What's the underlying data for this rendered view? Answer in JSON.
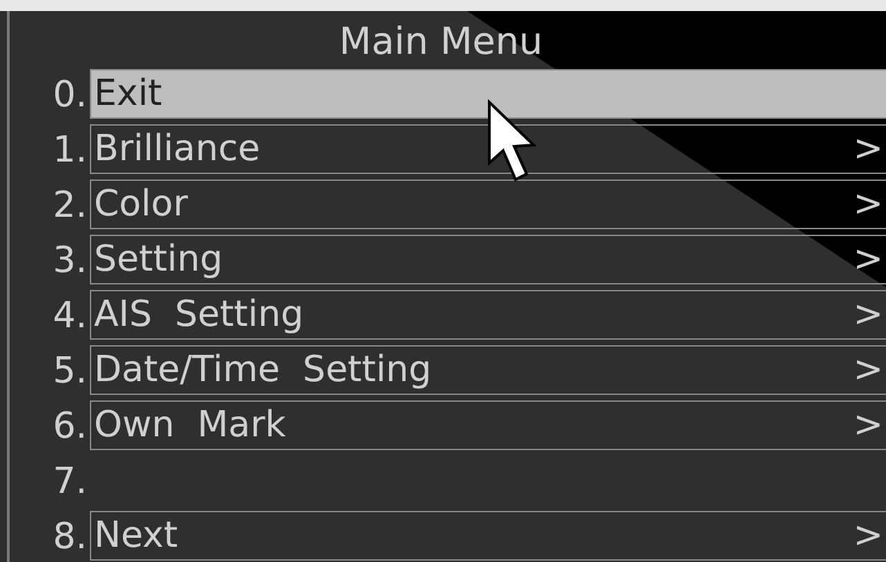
{
  "menu": {
    "title": "Main Menu",
    "items": [
      {
        "kind": "entry",
        "number": "0.",
        "label": "Exit",
        "selected": true
      },
      {
        "kind": "entry",
        "number": "1.",
        "label": "Brilliance",
        "selected": false,
        "arrow": ">"
      },
      {
        "kind": "entry",
        "number": "2.",
        "label": "Color",
        "selected": false,
        "arrow": ">"
      },
      {
        "kind": "entry",
        "number": "3.",
        "label": "Setting",
        "selected": false,
        "arrow": ">"
      },
      {
        "kind": "entry",
        "number": "4.",
        "label": "AIS  Setting",
        "selected": false,
        "arrow": ">"
      },
      {
        "kind": "entry",
        "number": "5.",
        "label": "Date/Time  Setting",
        "selected": false,
        "arrow": ">"
      },
      {
        "kind": "entry",
        "number": "6.",
        "label": "Own  Mark",
        "selected": false,
        "arrow": ">"
      },
      {
        "kind": "blank",
        "number": "7."
      },
      {
        "kind": "entry",
        "number": "8.",
        "label": "Next",
        "selected": false,
        "arrow": ">"
      }
    ]
  }
}
